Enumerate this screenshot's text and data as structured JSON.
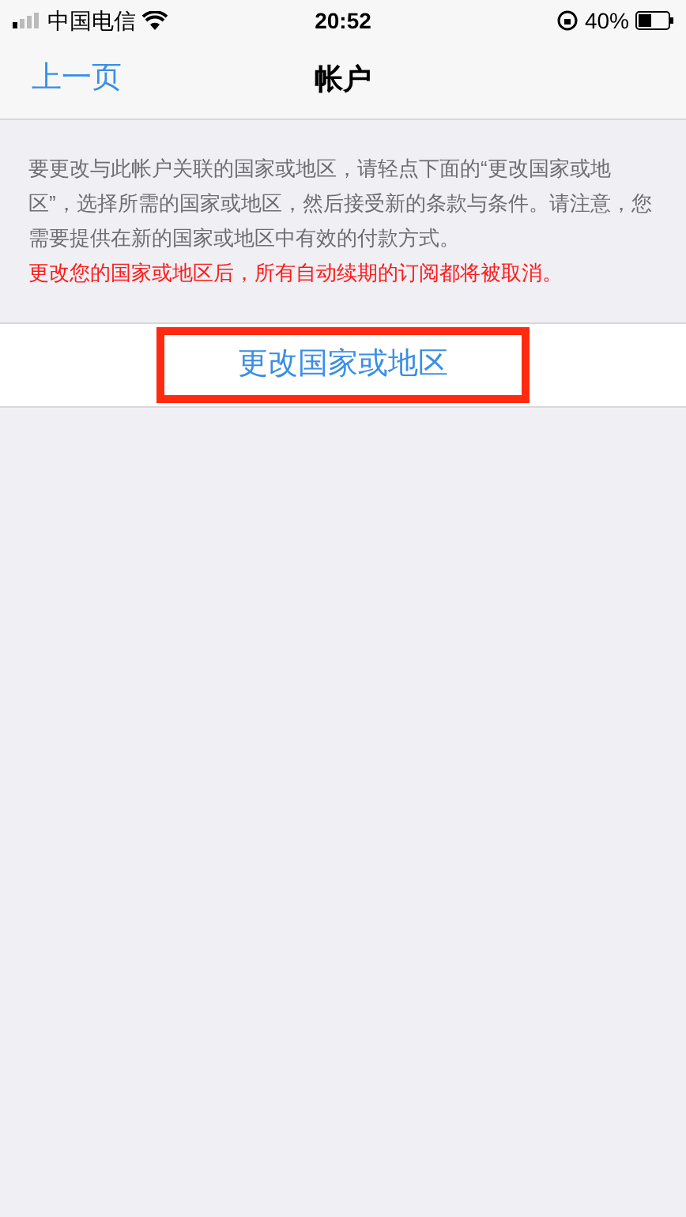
{
  "status_bar": {
    "carrier": "中国电信",
    "time": "20:52",
    "battery": "40%"
  },
  "nav": {
    "back": "上一页",
    "title": "帐户"
  },
  "notice": "要更改与此帐户关联的国家或地区，请轻点下面的“更改国家或地区”，选择所需的国家或地区，然后接受新的条款与条件。请注意，您需要提供在新的国家或地区中有效的付款方式。",
  "warning": "更改您的国家或地区后，所有自动续期的订阅都将被取消。",
  "action": {
    "label": "更改国家或地区",
    "highlighted": true
  }
}
